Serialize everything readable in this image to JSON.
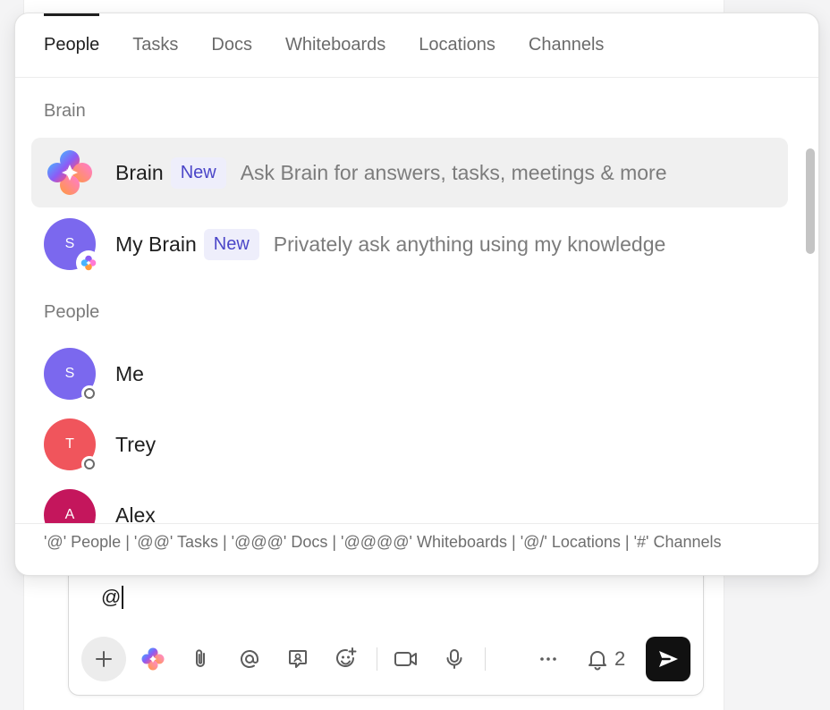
{
  "tabs": [
    {
      "label": "People",
      "active": true
    },
    {
      "label": "Tasks",
      "active": false
    },
    {
      "label": "Docs",
      "active": false
    },
    {
      "label": "Whiteboards",
      "active": false
    },
    {
      "label": "Locations",
      "active": false
    },
    {
      "label": "Channels",
      "active": false
    }
  ],
  "sections": {
    "brain": "Brain",
    "people": "People"
  },
  "brain_items": [
    {
      "name": "Brain",
      "badge": "New",
      "description": "Ask Brain for answers, tasks, meetings & more",
      "icon": "brain-icon",
      "highlighted": true
    },
    {
      "name": "My Brain",
      "badge": "New",
      "description": "Privately ask anything using my knowledge",
      "initial": "S",
      "avatar_color": "#7b68ee"
    }
  ],
  "people": [
    {
      "name": "Me",
      "initial": "S",
      "avatar_color": "#7b68ee",
      "status": "offline"
    },
    {
      "name": "Trey",
      "initial": "T",
      "avatar_color": "#f0555c",
      "status": "offline"
    },
    {
      "name": "Alex",
      "initial": "A",
      "avatar_color": "#c4165c",
      "status": "offline"
    }
  ],
  "footer_hint": "'@' People | '@@' Tasks | '@@@' Docs | '@@@@' Whiteboards | '@/' Locations | '#' Channels",
  "composer": {
    "text": "@",
    "notification_count": "2"
  },
  "toolbar_icons": [
    "plus-icon",
    "brain-icon",
    "paperclip-icon",
    "at-icon",
    "clip-message-icon",
    "emoji-icon",
    "video-icon",
    "microphone-icon",
    "more-icon",
    "bell-icon",
    "send-icon"
  ]
}
